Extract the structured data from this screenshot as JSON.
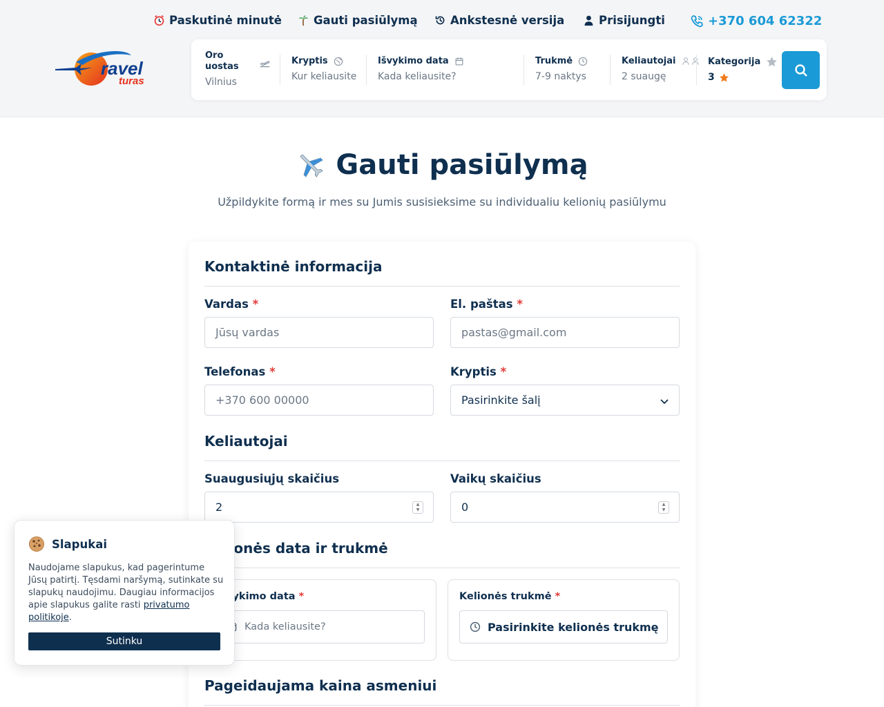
{
  "topnav": {
    "last_minute": "Paskutinė minutė",
    "get_offer": "Gauti pasiūlymą",
    "previous_version": "Ankstesnė versija",
    "login": "Prisijungti",
    "phone": "+370 604 62322"
  },
  "logo": {
    "word1": "ravel",
    "word2": "turas"
  },
  "search": {
    "airport": {
      "label_line1": "Oro",
      "label_line2": "uostas",
      "value": "Vilnius"
    },
    "destination": {
      "label": "Kryptis",
      "value": "Kur keliausite"
    },
    "departure": {
      "label": "Išvykimo data",
      "value": "Kada keliausite?"
    },
    "duration": {
      "label": "Trukmė",
      "value": "7-9 naktys"
    },
    "travelers": {
      "label": "Keliautojai",
      "value": "2 suaugę"
    },
    "category": {
      "label": "Kategorija",
      "value": "3"
    }
  },
  "page": {
    "title": "Gauti pasiūlymą",
    "subtitle": "Užpildykite formą ir mes su Jumis susisieksime su individualiu kelionių pasiūlymu"
  },
  "form": {
    "contact": {
      "title": "Kontaktinė informacija",
      "name_label": "Vardas",
      "name_placeholder": "Jūsų vardas",
      "email_label": "El. paštas",
      "email_placeholder": "pastas@gmail.com",
      "phone_label": "Telefonas",
      "phone_placeholder": "+370 600 00000",
      "destination_label": "Kryptis",
      "destination_value": "Pasirinkite šalį"
    },
    "travelers": {
      "title": "Keliautojai",
      "adults_label": "Suaugusiųjų skaičius",
      "adults_value": "2",
      "children_label": "Vaikų skaičius",
      "children_value": "0"
    },
    "trip": {
      "title": "Kelionės data ir trukmė",
      "date_label": "Išvykimo data",
      "date_placeholder": "Kada keliausite?",
      "duration_label": "Kelionės trukmė",
      "duration_value": "Pasirinkite kelionės trukmę"
    },
    "price": {
      "title": "Pageidaujama kaina asmeniui"
    },
    "required_mark": "*"
  },
  "cookie": {
    "title": "Slapukai",
    "text": "Naudojame slapukus, kad pagerintume Jūsų patirtį. Tęsdami naršymą, sutinkate su slapukų naudojimu. Daugiau informacijos apie slapukus galite rasti",
    "link": "privatumo politikoje",
    "period": ".",
    "button": "Sutinku"
  },
  "colors": {
    "primary": "#0f2f4f",
    "accent": "#1a9ad6",
    "required": "#e53935",
    "star": "#f07a1a"
  }
}
